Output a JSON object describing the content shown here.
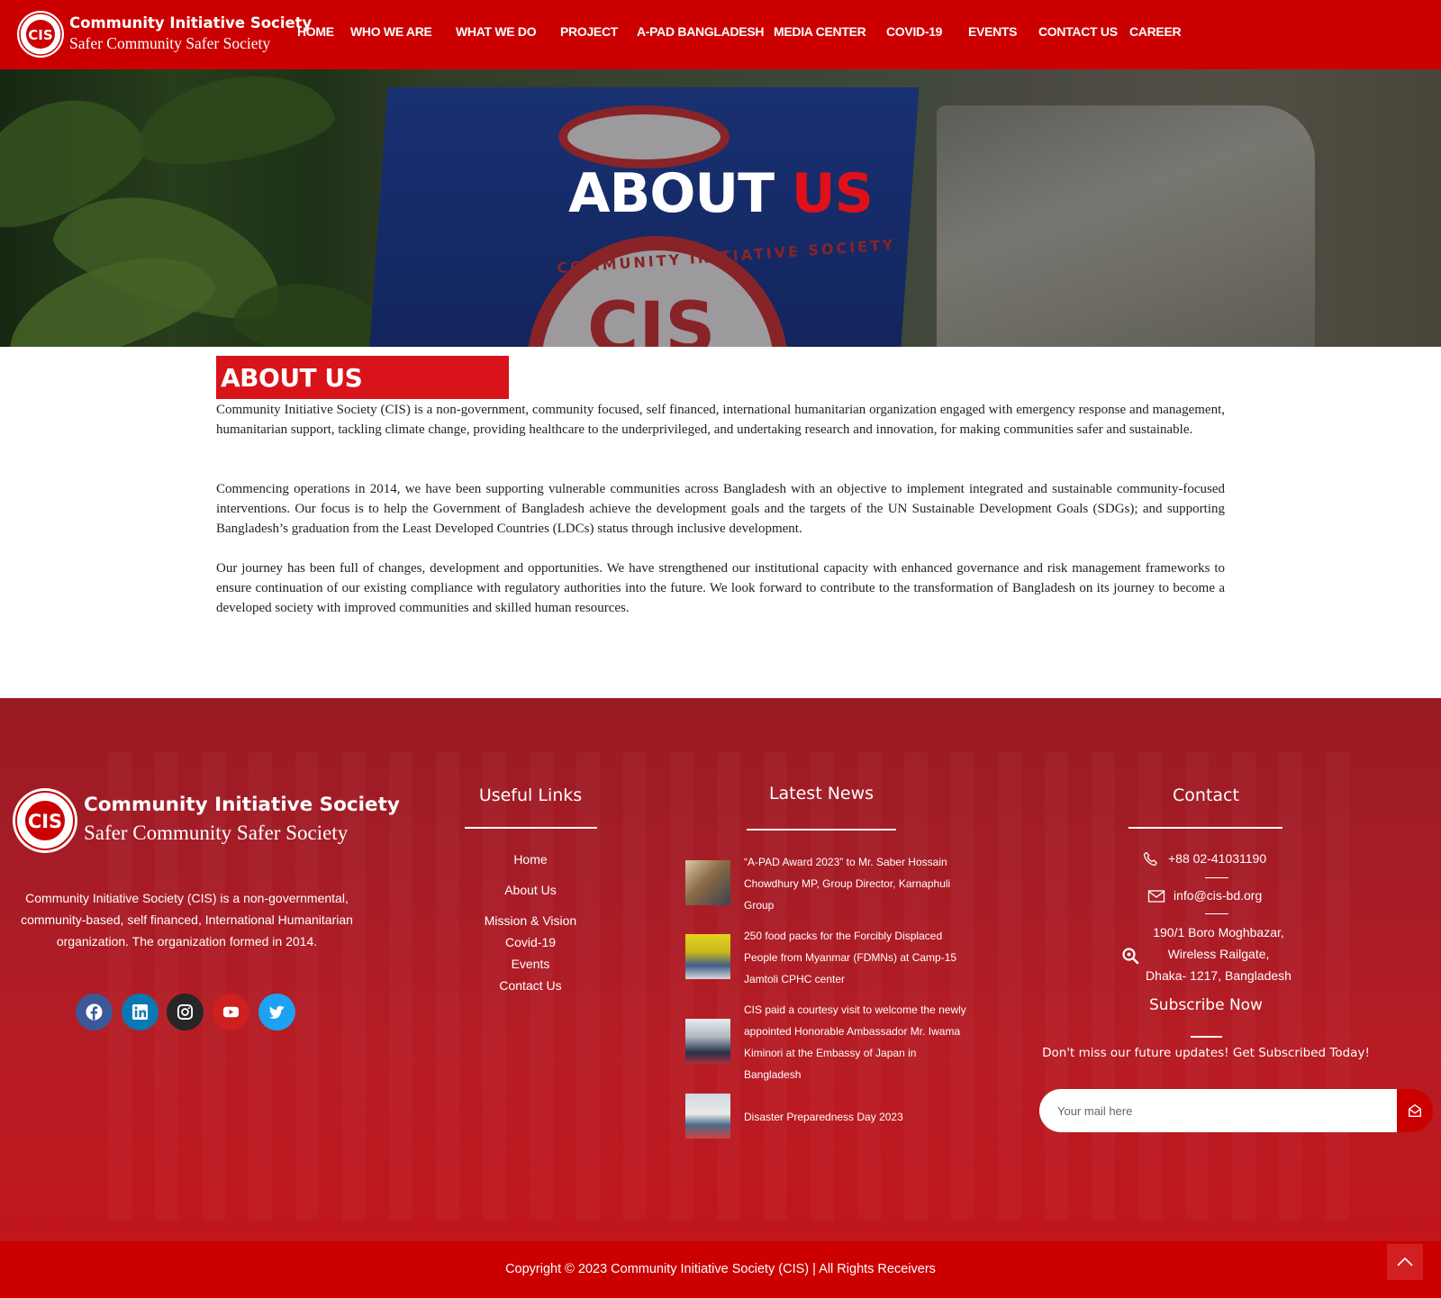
{
  "header": {
    "logo_text": "CIS",
    "brand_name": "Community Initiative Society",
    "tagline": "Safer Community Safer Society",
    "nav": [
      {
        "label": "HOME"
      },
      {
        "label": "WHO WE ARE"
      },
      {
        "label": "WHAT WE DO"
      },
      {
        "label": "PROJECT"
      },
      {
        "label": "A-PAD BANGLADESH"
      },
      {
        "label": "MEDIA CENTER"
      },
      {
        "label": "COVID-19"
      },
      {
        "label": "EVENTS"
      },
      {
        "label": "CONTACT US"
      },
      {
        "label": "CAREER"
      }
    ]
  },
  "hero": {
    "title_main": "ABOUT",
    "title_accent": "US",
    "seal_text": "CIS",
    "seal_ring_text": "COMMUNITY INITIATIVE SOCIETY"
  },
  "about": {
    "heading": "ABOUT US",
    "paragraphs": [
      "Community Initiative Society (CIS) is a non-government, community focused, self financed, international humanitarian organization engaged with emergency response and management, humanitarian support, tackling climate change, providing healthcare to the underprivileged, and undertaking research and innovation, for making communities safer and sustainable.",
      "Commencing operations in 2014, we have been supporting vulnerable communities across Bangladesh with an objective to implement integrated and sustainable community-focused interventions. Our focus is to help the Government of Bangladesh achieve the development goals and the targets of the UN Sustainable Development Goals (SDGs); and supporting Bangladesh’s graduation from the Least Developed Countries (LDCs) status through inclusive development.",
      "Our journey has been full of changes, development and opportunities. We have strengthened our institutional capacity with enhanced governance and risk management frameworks to ensure continuation of our existing compliance with regulatory authorities into the future. We look forward to contribute to the transformation of Bangladesh on its journey to become a developed society with improved communities and skilled human resources."
    ]
  },
  "footer": {
    "brand_name": "Community Initiative Society",
    "tagline": "Safer Community Safer Society",
    "description": "Community Initiative Society (CIS) is a non-governmental, community-based, self financed, International Humanitarian organization. The organization formed in 2014.",
    "social": [
      {
        "icon": "facebook-icon",
        "color": "#3b5998"
      },
      {
        "icon": "linkedin-icon",
        "color": "#0a78b5"
      },
      {
        "icon": "instagram-icon",
        "color": "#262626"
      },
      {
        "icon": "youtube-icon",
        "color": "#cd201f"
      },
      {
        "icon": "twitter-icon",
        "color": "#1da1f2"
      }
    ],
    "useful_links": {
      "heading": "Useful Links",
      "items": [
        "Home",
        "About Us",
        "Mission & Vision",
        "Covid-19",
        "Events",
        "Contact Us"
      ]
    },
    "latest_news": {
      "heading": "Latest News",
      "items": [
        "“A-PAD Award 2023” to Mr. Saber Hossain Chowdhury MP, Group Director, Karnaphuli Group",
        "250 food packs for the Forcibly Displaced People from Myanmar (FDMNs) at Camp-15 Jamtoli CPHC center",
        "CIS paid a courtesy visit to welcome the newly appointed Honorable Ambassador Mr. Iwama Kiminori at the Embassy of Japan in Bangladesh",
        "Disaster Preparedness Day 2023"
      ]
    },
    "contact": {
      "heading": "Contact",
      "phone": "+88 02-41031190",
      "email": "info@cis-bd.org",
      "address_lines": [
        "190/1 Boro Moghbazar,",
        "Wireless Railgate,",
        "Dhaka- 1217, Bangladesh"
      ],
      "subscribe_heading": "Subscribe Now",
      "subscribe_text": "Don't miss our future updates! Get Subscribed Today!",
      "email_placeholder": "Your mail here"
    },
    "copyright": "Copyright © 2023 Community Initiative Society (CIS) | All Rights Receivers"
  },
  "colors": {
    "brand_red": "#cc0000",
    "accent_red": "#e0101a",
    "footer_red": "#a51c26"
  }
}
